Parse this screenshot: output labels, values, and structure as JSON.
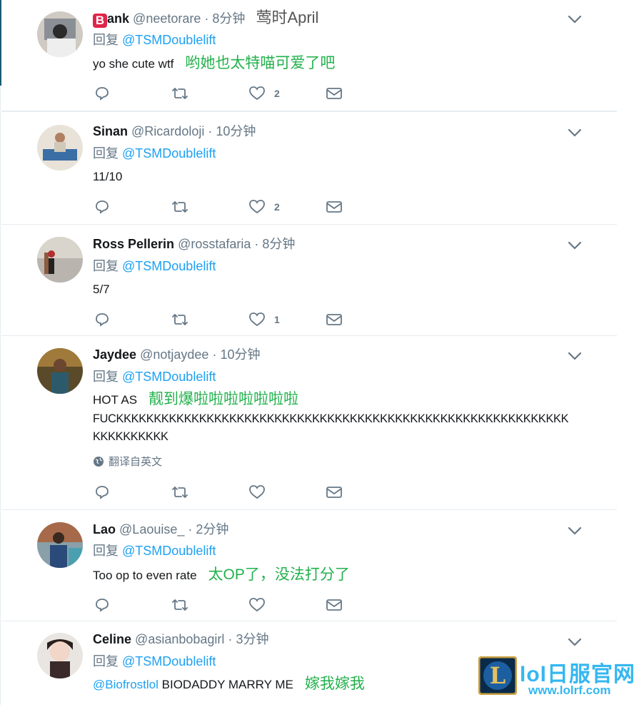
{
  "colors": {
    "link": "#1da1f2",
    "annotation": "#22b14c",
    "muted": "#657786",
    "watermark": "#35b7f0"
  },
  "tweets": [
    {
      "name_badge": "B",
      "name": "ank",
      "handle": "@neetorare",
      "time": "8分钟",
      "header_annotation": "莺时April",
      "reply_prefix": "回复",
      "reply_to": "@TSMDoublelift",
      "body": "yo she cute wtf",
      "body_annotation": "哟她也太特喵可爱了吧",
      "likes": "2"
    },
    {
      "name": "Sinan",
      "handle": "@Ricardoloji",
      "time": "10分钟",
      "reply_prefix": "回复",
      "reply_to": "@TSMDoublelift",
      "body": "11/10",
      "likes": "2"
    },
    {
      "name": "Ross Pellerin",
      "handle": "@rosstafaria",
      "time": "8分钟",
      "reply_prefix": "回复",
      "reply_to": "@TSMDoublelift",
      "body": "5/7",
      "likes": "1"
    },
    {
      "name": "Jaydee",
      "handle": "@notjaydee",
      "time": "10分钟",
      "reply_prefix": "回复",
      "reply_to": "@TSMDoublelift",
      "body": "HOT AS",
      "body_annotation": "靓到爆啦啦啦啦啦啦啦",
      "body_line2": "FUCKKKKKKKKKKKKKKKKKKKKKKKKKKKKKKKKKKKKKKKKKKKKKKKKKKKKKKKKKKKK",
      "body_line3": "KKKKKKKKKK",
      "translate": "翻译自英文",
      "likes": ""
    },
    {
      "name": "Lao",
      "handle": "@Laouise_",
      "time": "2分钟",
      "reply_prefix": "回复",
      "reply_to": "@TSMDoublelift",
      "body": "Too op to even rate",
      "body_annotation": "太OP了，没法打分了",
      "likes": ""
    },
    {
      "name": "Celine",
      "handle": "@asianbobagirl",
      "time": "3分钟",
      "reply_prefix": "回复",
      "reply_to": "@TSMDoublelift",
      "body_mention": "@Biofrostlol",
      "body": "BIODADDY MARRY ME",
      "body_annotation": "嫁我嫁我"
    }
  ],
  "separator_dot": "·",
  "watermark": {
    "title": "lol日服官网",
    "url": "www.lolrf.com",
    "logo_letter": "L"
  },
  "icons": {
    "reply": "reply-icon",
    "retweet": "retweet-icon",
    "like": "heart-icon",
    "dm": "mail-icon",
    "caret": "chevron-down-icon",
    "globe": "globe-icon"
  }
}
